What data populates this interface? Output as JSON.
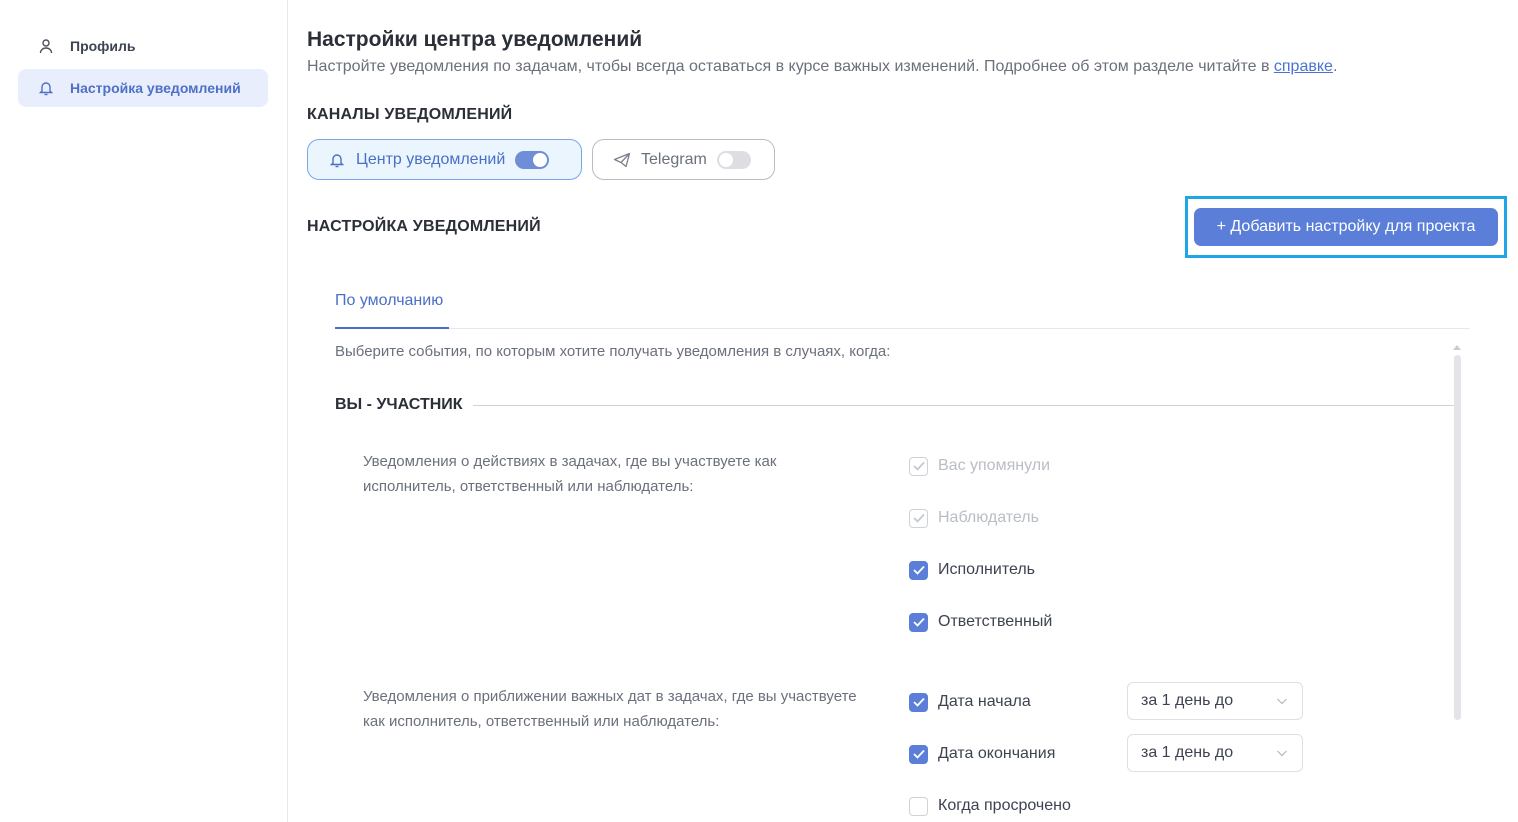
{
  "sidebar": {
    "items": [
      {
        "label": "Профиль",
        "icon": "user-icon",
        "active": false
      },
      {
        "label": "Настройка уведомлений",
        "icon": "bell-icon",
        "active": true
      }
    ]
  },
  "header": {
    "title": "Настройки центра уведомлений",
    "subtitle_text": "Настройте уведомления по задачам, чтобы всегда оставаться в курсе важных изменений. Подробнее об этом разделе читайте в ",
    "subtitle_link": "справке",
    "subtitle_end": "."
  },
  "channels": {
    "heading": "КАНАЛЫ УВЕДОМЛЕНИЙ",
    "items": [
      {
        "label": "Центр уведомлений",
        "icon": "bell-icon",
        "enabled": true
      },
      {
        "label": "Telegram",
        "icon": "telegram-send-icon",
        "enabled": false
      }
    ]
  },
  "settings": {
    "heading": "НАСТРОЙКА УВЕДОМЛЕНИЙ",
    "add_button": "+ Добавить настройку для проекта",
    "tabs": [
      {
        "label": "По умолчанию",
        "active": true
      }
    ],
    "hint": "Выберите события, по которым хотите получать уведомления в случаях, когда:",
    "group": {
      "title": "ВЫ - УЧАСТНИК",
      "block1": {
        "description": "Уведомления о действиях в задачах, где вы участвуете как исполнитель, ответственный или наблюдатель:",
        "options": [
          {
            "label": "Вас упомянули",
            "checked": true,
            "disabled": true
          },
          {
            "label": "Наблюдатель",
            "checked": true,
            "disabled": true
          },
          {
            "label": "Исполнитель",
            "checked": true,
            "disabled": false
          },
          {
            "label": "Ответственный",
            "checked": true,
            "disabled": false
          }
        ]
      },
      "block2": {
        "description": "Уведомления о приближении важных дат в задачах, где вы участвуете как исполнитель, ответственный или наблюдатель:",
        "options": [
          {
            "label": "Дата начала",
            "checked": true,
            "select": "за 1 день до"
          },
          {
            "label": "Дата окончания",
            "checked": true,
            "select": "за 1 день до"
          },
          {
            "label": "Когда просрочено",
            "checked": false
          }
        ]
      }
    }
  },
  "colors": {
    "accent": "#5b7fd8",
    "highlight_border": "#1ea6e6"
  }
}
